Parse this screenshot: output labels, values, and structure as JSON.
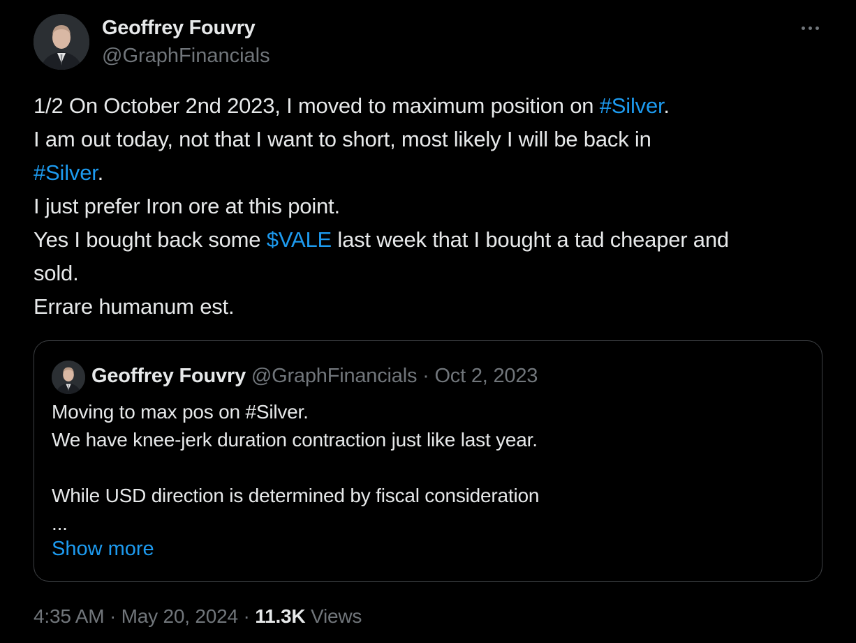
{
  "tweet": {
    "author": {
      "name": "Geoffrey Fouvry",
      "handle": "@GraphFinancials",
      "avatar": "profile-photo"
    },
    "more_icon": "more-horizontal-icon",
    "text": {
      "line1_pre": "1/2 On October 2nd 2023, I moved to maximum position on ",
      "line1_link": "#Silver",
      "line1_post": ".",
      "line2": "I am out today, not that I want to short, most likely I will be back in",
      "line3_link": "#Silver",
      "line3_post": ".",
      "line4": "I just prefer Iron ore at this point.",
      "line5_pre": "Yes I bought back some ",
      "line5_link": "$VALE",
      "line5_post": " last week that I bought a tad cheaper and",
      "line6": "sold.",
      "line7": "Errare humanum est."
    },
    "quote": {
      "name": "Geoffrey Fouvry",
      "handle": "@GraphFinancials",
      "separator": "·",
      "date": "Oct 2, 2023",
      "lines": [
        "Moving to max pos on #Silver.",
        "We have knee-jerk duration contraction just like last year.",
        "",
        "While USD direction is determined by fiscal consideration",
        "..."
      ],
      "show_more": "Show more"
    },
    "footer": {
      "time": "4:35 AM",
      "separator1": "·",
      "date": "May 20, 2024",
      "separator2": "·",
      "views_count": "11.3K",
      "views_label": "Views"
    },
    "colors": {
      "background": "#000000",
      "text": "#e7e9ea",
      "muted": "#71767b",
      "link": "#1d9bf0",
      "border": "#3e4144"
    }
  }
}
